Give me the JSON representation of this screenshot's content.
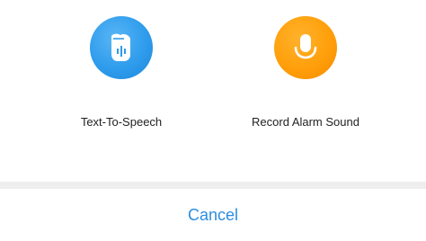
{
  "options": [
    {
      "label": "Text-To-Speech",
      "icon": "text-to-speech-icon",
      "color": "#2f9cec"
    },
    {
      "label": "Record Alarm Sound",
      "icon": "microphone-icon",
      "color": "#ff9f0a"
    }
  ],
  "cancel": {
    "label": "Cancel",
    "color": "#2c8de0"
  },
  "divider_color": "#eeeeee"
}
